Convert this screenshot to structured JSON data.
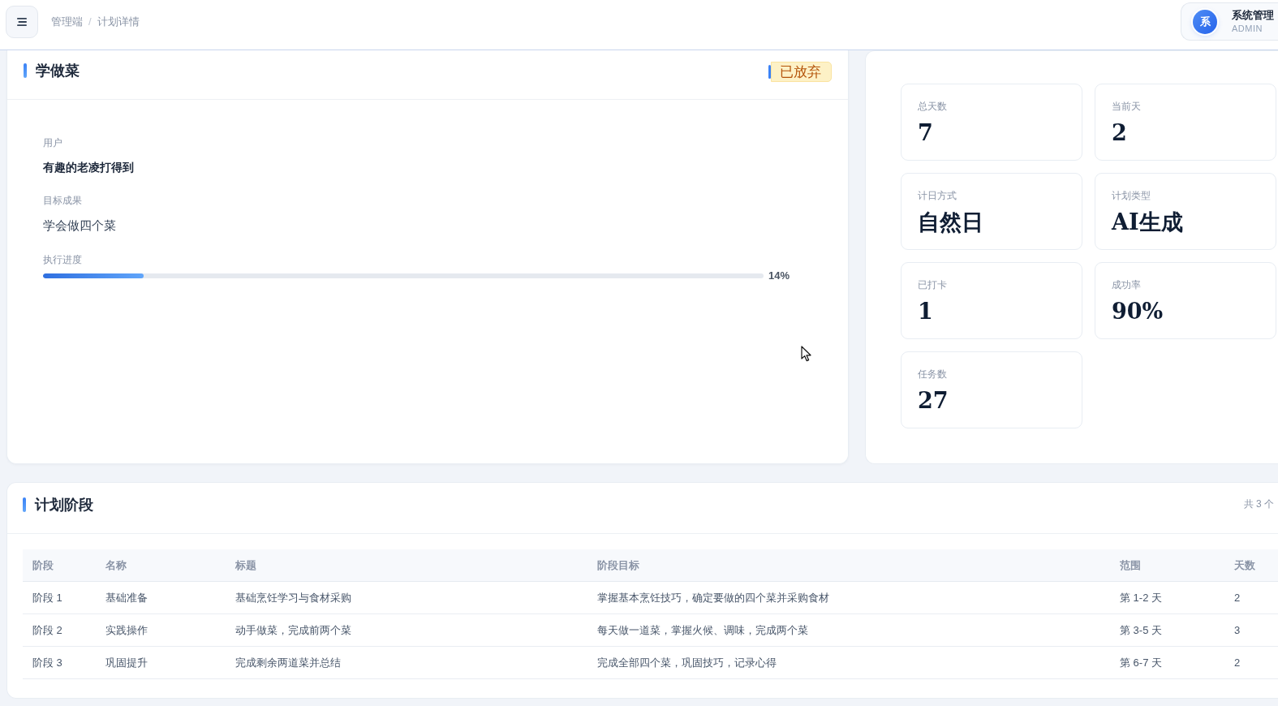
{
  "top_bar": {
    "breadcrumb": {
      "items": [
        "管理端",
        "计划详情"
      ],
      "separator": "/"
    },
    "user": {
      "avatar": "系",
      "name": "系统管理",
      "role": "ADMIN"
    }
  },
  "plan": {
    "title": "学做菜",
    "status": {
      "label": "已放弃",
      "kind": "abandoned"
    },
    "fields": [
      {
        "label": "用户",
        "value": "有趣的老凌打得到",
        "kind": "strong"
      },
      {
        "label": "目标成果",
        "value": "学会做四个菜",
        "kind": "plain"
      }
    ],
    "progress": {
      "label": "执行进度",
      "level": 0.14,
      "reading": "14%"
    }
  },
  "stats": [
    {
      "label": "总天数",
      "value": "7"
    },
    {
      "label": "当前天",
      "value": "2"
    },
    {
      "label": "计日方式",
      "value": "自然日"
    },
    {
      "label": "计划类型",
      "value": "AI生成"
    },
    {
      "label": "已打卡",
      "value": "1"
    },
    {
      "label": "成功率",
      "value": "90%"
    },
    {
      "label": "任务数",
      "value": "27"
    }
  ],
  "phases": {
    "title": "计划阶段",
    "summary": "共 3 个",
    "table": {
      "columns": [
        "阶段",
        "名称",
        "标题",
        "阶段目标",
        "范围",
        "天数"
      ],
      "rows": [
        [
          "阶段 1",
          "基础准备",
          "基础烹饪学习与食材采购",
          "掌握基本烹饪技巧，确定要做的四个菜并采购食材",
          "第 1-2 天",
          "2"
        ],
        [
          "阶段 2",
          "实践操作",
          "动手做菜，完成前两个菜",
          "每天做一道菜，掌握火候、调味，完成两个菜",
          "第 3-5 天",
          "3"
        ],
        [
          "阶段 3",
          "巩固提升",
          "完成剩余两道菜并总结",
          "完成全部四个菜，巩固技巧，记录心得",
          "第 6-7 天",
          "2"
        ]
      ]
    }
  }
}
